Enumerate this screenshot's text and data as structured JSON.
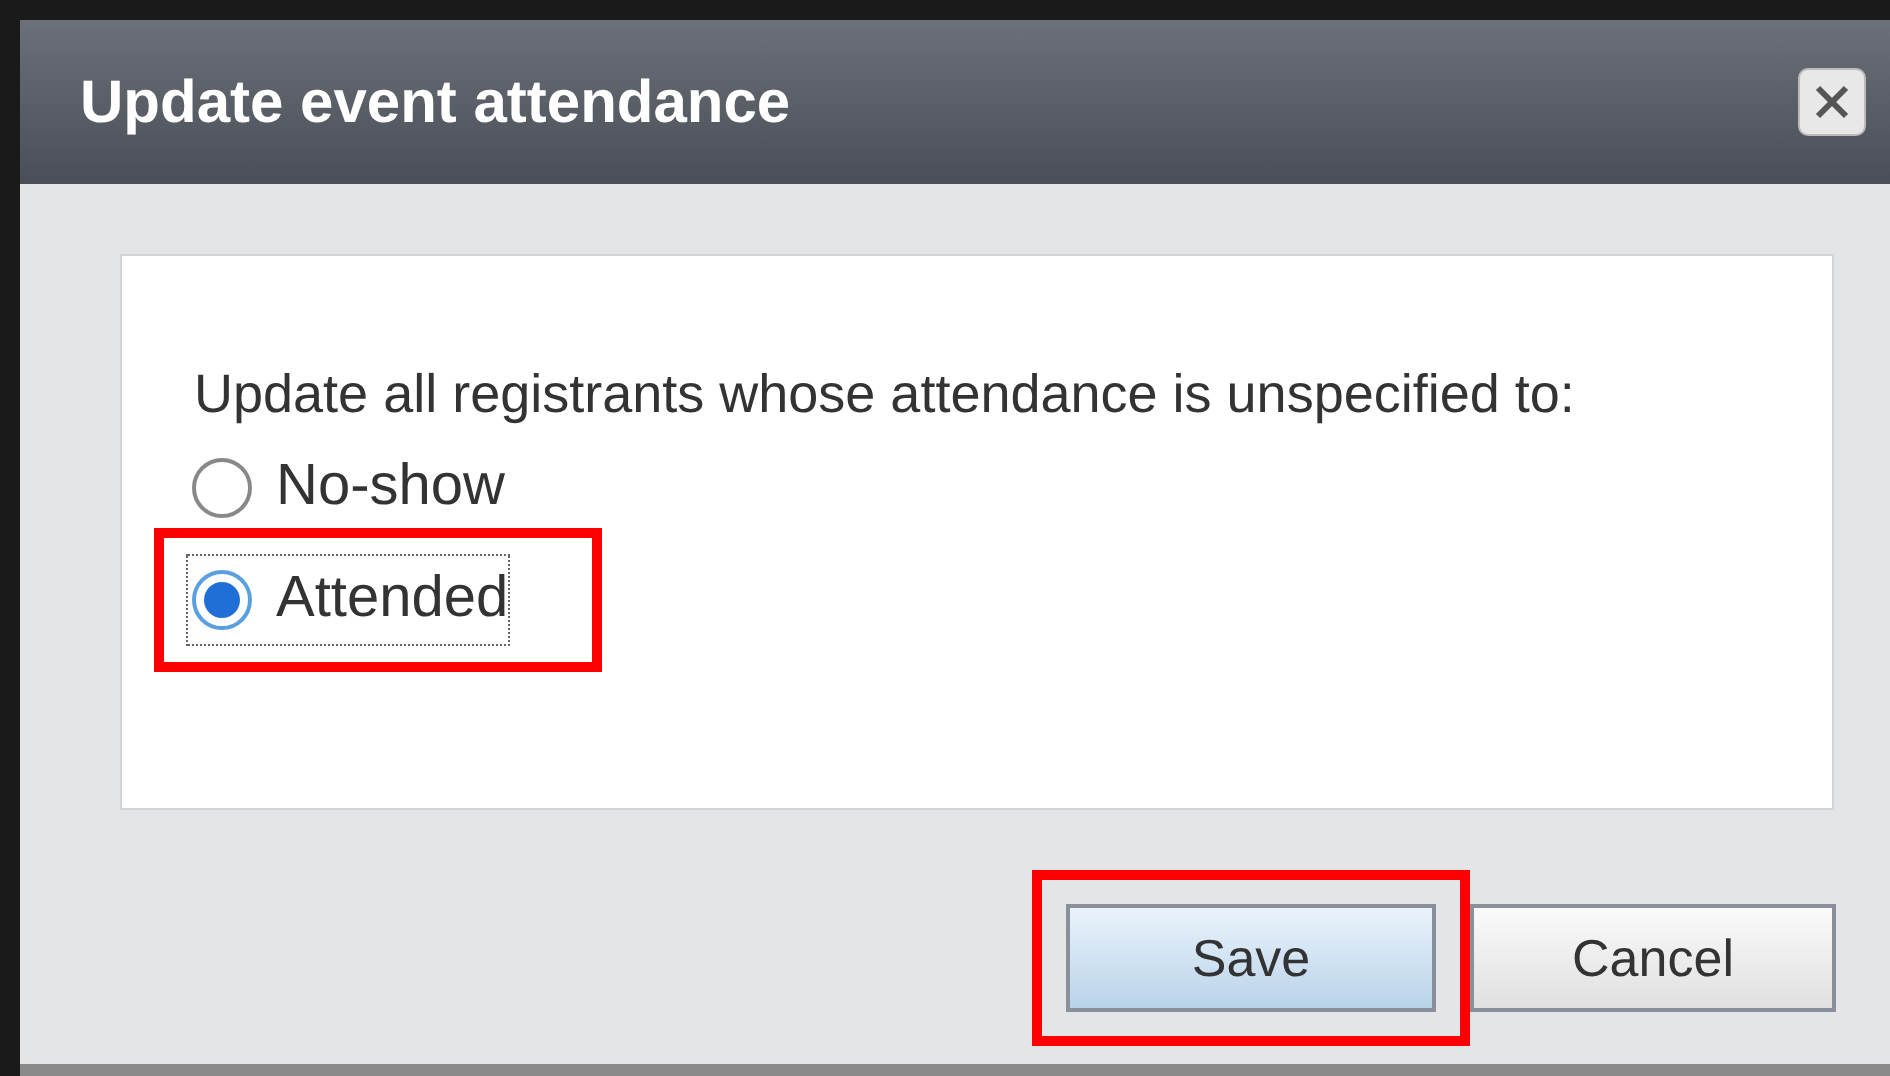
{
  "dialog": {
    "title": "Update event attendance"
  },
  "prompt": "Update all registrants whose attendance is unspecified to:",
  "options": [
    {
      "label": "No-show",
      "selected": false,
      "highlighted": false
    },
    {
      "label": "Attended",
      "selected": true,
      "highlighted": true
    }
  ],
  "buttons": [
    {
      "label": "Save",
      "focused": true,
      "highlighted": true
    },
    {
      "label": "Cancel",
      "focused": false,
      "highlighted": false
    }
  ]
}
